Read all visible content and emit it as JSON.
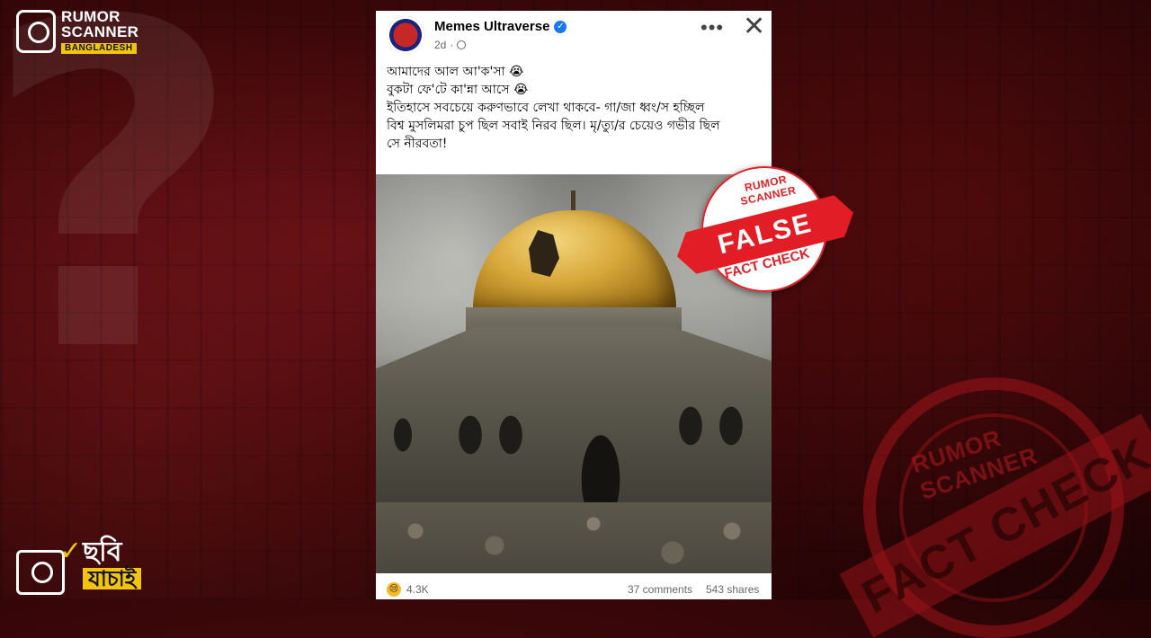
{
  "brand": {
    "line1": "RUMOR",
    "line2": "SCANNER",
    "line3": "BANGLADESH"
  },
  "bottom_logo": {
    "word1": "ছবি",
    "word2": "যাচাই"
  },
  "post": {
    "page_name": "Memes Ultraverse",
    "time": "2d",
    "text_lines": [
      "আমাদের আল আ'ক'সা 😭",
      "বুকটা ফে'টে কা'ন্না আসে 😭",
      "ইতিহাসে সবচেয়ে করুণভাবে লেখা থাকবে- গা/জা ধ্বং/স হচ্ছিল",
      "বিশ্ব মুসলিমরা চুপ ছিল সবাই নিরব ছিল। মৃ/ত্যু/র চেয়েও গভীর ছিল",
      "সে নীরবতা!"
    ],
    "reaction_emoji": "😢",
    "reaction_count": "4.3K",
    "comments": "37 comments",
    "shares": "543 shares"
  },
  "stamp": {
    "top": "RUMOR SCANNER",
    "label": "FALSE",
    "bottom": "FACT CHECK"
  },
  "watermark": {
    "top": "RUMOR SCANNER",
    "band": "FACT CHECK"
  },
  "colors": {
    "accent_red": "#e21d25",
    "brand_yellow": "#f1c40f",
    "facebook_blue": "#1877f2"
  }
}
